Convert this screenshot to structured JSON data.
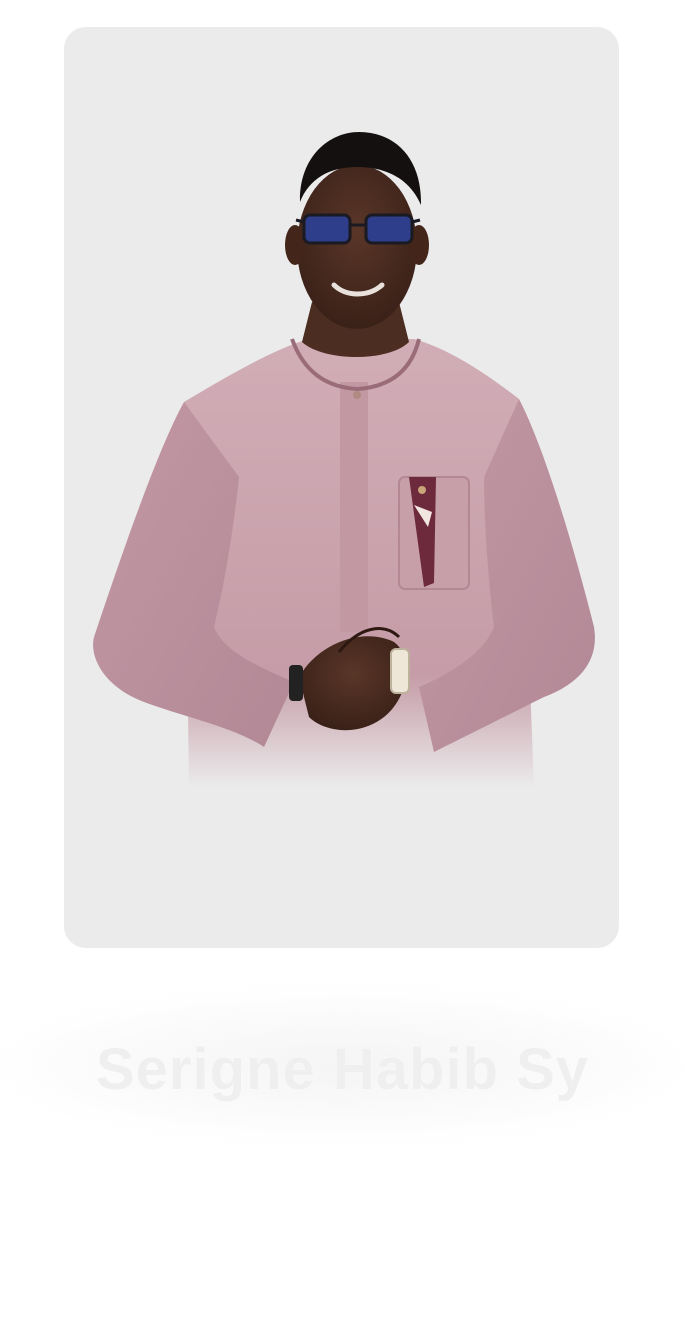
{
  "profile": {
    "name": "Serigne Habib Sy"
  },
  "photo": {
    "subject": "portrait-of-man-in-pink-kaftan",
    "card_background": "#ebebeb"
  },
  "colors": {
    "garment": "#c9a3ad",
    "garment_shadow": "#a97d8a",
    "skin": "#4a2c22",
    "name_text": "#efefef"
  }
}
